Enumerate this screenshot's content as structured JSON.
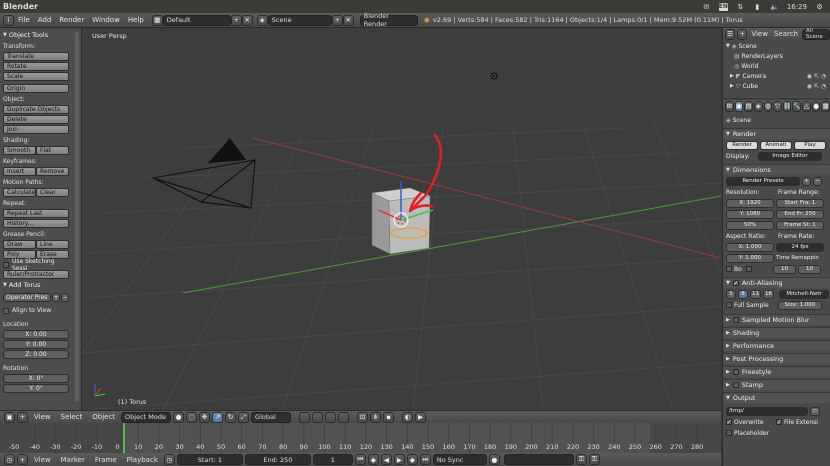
{
  "os_bar": {
    "title": "Blender",
    "keyboard": "EN",
    "clock": "16:29"
  },
  "info_header": {
    "menus": [
      "File",
      "Add",
      "Render",
      "Window",
      "Help"
    ],
    "screen_layout": "Default",
    "scene": "Scene",
    "render_engine": "Blender Render",
    "stats": "v2.69 | Verts:584 | Faces:582 | Tris:1164 | Objects:1/4 | Lamps:0/1 | Mem:9.52M (0.11M) | Torus"
  },
  "tool_shelf": {
    "title": "Object Tools",
    "transform_label": "Transform:",
    "translate": "Translate",
    "rotate": "Rotate",
    "scale": "Scale",
    "origin": "Origin",
    "object_label": "Object:",
    "duplicate": "Duplicate Objects",
    "delete": "Delete",
    "join": "Join",
    "shading_label": "Shading:",
    "smooth": "Smooth",
    "flat": "Flat",
    "keyframes_label": "Keyframes:",
    "insert": "Insert",
    "remove": "Remove",
    "motion_label": "Motion Paths:",
    "calculate": "Calculate",
    "clear": "Clear",
    "repeat_label": "Repeat:",
    "repeat_last": "Repeat Last",
    "history": "History...",
    "grease_label": "Grease Pencil:",
    "draw": "Draw",
    "line": "Line",
    "poly": "Poly",
    "erase": "Erase",
    "use_sketching": "Use Sketching Sessi",
    "ruler": "Ruler/Protractor",
    "add_torus": "Add Torus",
    "operator_presets": "Operator Pres",
    "align_to_view": "Align to View",
    "location_label": "Location",
    "loc_x": "X: 0.00",
    "loc_y": "Y: 0.00",
    "loc_z": "Z: 0.00",
    "rotation_label": "Rotation",
    "rot_x": "X: 0°",
    "rot_y": "Y: 0°"
  },
  "viewport": {
    "view_label": "User Persp",
    "object_label": "(1) Torus"
  },
  "viewport_header": {
    "view": "View",
    "select": "Select",
    "object": "Object",
    "mode": "Object Mode",
    "orientation": "Global"
  },
  "timeline": {
    "ticks": [
      "-50",
      "-40",
      "-30",
      "-20",
      "-10",
      "0",
      "10",
      "20",
      "30",
      "40",
      "50",
      "60",
      "70",
      "80",
      "90",
      "100",
      "110",
      "120",
      "130",
      "140",
      "150",
      "160",
      "170",
      "180",
      "190",
      "200",
      "210",
      "220",
      "230",
      "240",
      "250",
      "260",
      "270",
      "280"
    ],
    "current_frame": 1
  },
  "timeline_header": {
    "view": "View",
    "marker": "Marker",
    "frame": "Frame",
    "playback": "Playback",
    "start": "Start: 1",
    "end": "End: 250",
    "current": "1",
    "sync": "No Sync"
  },
  "outliner": {
    "view": "View",
    "search": "Search",
    "filter": "All Scene",
    "items": [
      "Scene",
      "RenderLayers",
      "World",
      "Camera",
      "Cube"
    ]
  },
  "properties": {
    "scene": "Scene",
    "render_section": "Render",
    "render_btn": "Render",
    "animation_btn": "Animati",
    "play_btn": "Play",
    "display_label": "Display:",
    "display_value": "Image Editor",
    "dimensions_section": "Dimensions",
    "render_presets": "Render Presets",
    "resolution_label": "Resolution:",
    "frame_range_label": "Frame Range:",
    "res_x": "X: 1920",
    "res_y": "Y: 1080",
    "res_pct": "50%",
    "start_frame": "Start Fra: 1",
    "end_frame": "End Fr: 250",
    "frame_step": "Frame St: 1",
    "aspect_label": "Aspect Ratio:",
    "frame_rate_label": "Frame Rate:",
    "aspect_x": "X: 1.000",
    "aspect_y": "Y: 1.000",
    "fps": "24 fps",
    "time_remap": "Time Remappin",
    "bo": "Bo",
    "remap_old": "10",
    "remap_new": "10",
    "aa_section": "Anti-Aliasing",
    "aa_samples": [
      "5",
      "8",
      "11",
      "16"
    ],
    "aa_filter": "Mitchell-Netr",
    "full_sample": "Full Sample",
    "aa_size": "Size: 1.000",
    "motion_blur": "Sampled Motion Blur",
    "shading": "Shading",
    "performance": "Performance",
    "post_processing": "Post Processing",
    "freestyle": "Freestyle",
    "stamp": "Stamp",
    "output": "Output",
    "output_path": "/tmp/",
    "overwrite": "Overwrite",
    "file_ext": "File Extensi",
    "placeholders": "Placeholder"
  }
}
